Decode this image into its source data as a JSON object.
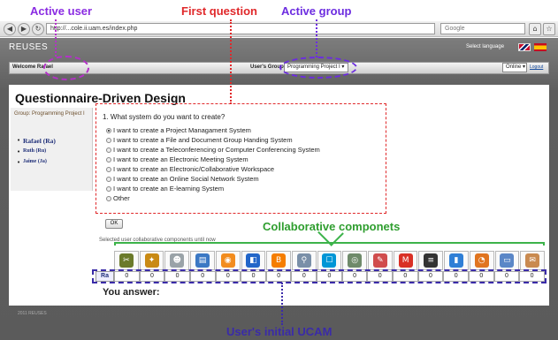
{
  "annotations": {
    "active_user": "Active user",
    "first_question": "First question",
    "active_group": "Active group",
    "collaborative_components": "Collaborative componets",
    "initial_ucam": "User's initial UCAM"
  },
  "browser": {
    "url": "http://...cole.ii.uam.es/index.php",
    "search_placeholder": "Google"
  },
  "app": {
    "title": "REUSES",
    "select_language": "Select language",
    "welcome": "Welcome Rafael",
    "group_label": "User's Group:",
    "group_value": "Programming Project I",
    "status_value": "Online",
    "logout": "Logout",
    "footer": "2011 REUSES"
  },
  "page": {
    "title": "Questionnaire-Driven Design"
  },
  "sidebar": {
    "group_name": "Group: Programming Project I",
    "members": [
      {
        "name": "Rafael (Ra)",
        "active": true
      },
      {
        "name": "Ruth (Ru)",
        "active": false
      },
      {
        "name": "Jaime (Ja)",
        "active": false
      }
    ]
  },
  "question": {
    "text": "1. What system do you want to create?",
    "options": [
      {
        "label": "I want to create a Project Managament System",
        "checked": true
      },
      {
        "label": "I want to create a File and Document Group Handing System",
        "checked": false
      },
      {
        "label": "I want to create a Teleconferencing or Computer Conferencing System",
        "checked": false
      },
      {
        "label": "I want to create an Electronic Meeting System",
        "checked": false
      },
      {
        "label": "I want to create an Electronic/Collaborative Workspace",
        "checked": false
      },
      {
        "label": "I want to create an Online Social Network System",
        "checked": false
      },
      {
        "label": "I want to create an E-learning System",
        "checked": false
      },
      {
        "label": "Other",
        "checked": false
      }
    ],
    "ok_label": "OK"
  },
  "components": {
    "label": "Selected user collaborative components until now",
    "icons": [
      {
        "name": "tools-icon",
        "glyph": "✂",
        "color": "#6b7a2a"
      },
      {
        "name": "puzzle-icon",
        "glyph": "✦",
        "color": "#c98a14"
      },
      {
        "name": "chat-icon",
        "glyph": "☻",
        "color": "#9aa3a8"
      },
      {
        "name": "forum-icon",
        "glyph": "▤",
        "color": "#3b78c4"
      },
      {
        "name": "rss-icon",
        "glyph": "◉",
        "color": "#f28c1e"
      },
      {
        "name": "shared-docs-icon",
        "glyph": "◧",
        "color": "#2266c9"
      },
      {
        "name": "blogger-icon",
        "glyph": "B",
        "color": "#f57d00"
      },
      {
        "name": "search-icon",
        "glyph": "⚲",
        "color": "#7a8fa8"
      },
      {
        "name": "calendar-icon",
        "glyph": "☐",
        "color": "#0096d6"
      },
      {
        "name": "magnifier-icon",
        "glyph": "◎",
        "color": "#6f8a6a"
      },
      {
        "name": "notes-icon",
        "glyph": "✎",
        "color": "#d04c4c"
      },
      {
        "name": "gmail-icon",
        "glyph": "M",
        "color": "#d93025"
      },
      {
        "name": "list-icon",
        "glyph": "≡",
        "color": "#333333"
      },
      {
        "name": "document-icon",
        "glyph": "▮",
        "color": "#2f7fd6"
      },
      {
        "name": "chart-icon",
        "glyph": "◔",
        "color": "#e0741f"
      },
      {
        "name": "window-icon",
        "glyph": "▭",
        "color": "#5b87c7"
      },
      {
        "name": "wiki-icon",
        "glyph": "✉",
        "color": "#c98a50"
      }
    ],
    "row_label": "Ra",
    "values": [
      "0",
      "0",
      "0",
      "0",
      "0",
      "0",
      "0",
      "0",
      "0",
      "0",
      "0",
      "0",
      "0",
      "0",
      "0",
      "0",
      "0"
    ]
  },
  "answer_label": "You answer:"
}
